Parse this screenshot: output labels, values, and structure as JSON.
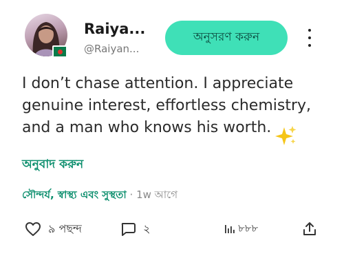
{
  "author": {
    "name": "Raiya...",
    "handle": "@Raiyan..."
  },
  "follow_button": {
    "label": "অনুসরণ করুন"
  },
  "post": {
    "text": "I don’t chase attention. I appreciate genuine interest, effortless chemistry, and a man who knows his worth.",
    "translate_label": "অনুবাদ করুন",
    "category": "সৌন্দর্য, স্বাস্থ্য এবং সুস্থতা",
    "separator": "·",
    "time": "1w আগে"
  },
  "actions": {
    "likes": "৯ পছন্দ",
    "comments": "২",
    "views": "৮৮৮"
  },
  "colors": {
    "accent": "#3fe0b7",
    "link": "#0d8f6e",
    "flag_green": "#0a7a4a",
    "flag_red": "#e0322d"
  },
  "icons": [
    "heart-icon",
    "comment-icon",
    "views-chart-icon",
    "share-icon",
    "more-vertical-icon",
    "sparkle-emoji"
  ]
}
